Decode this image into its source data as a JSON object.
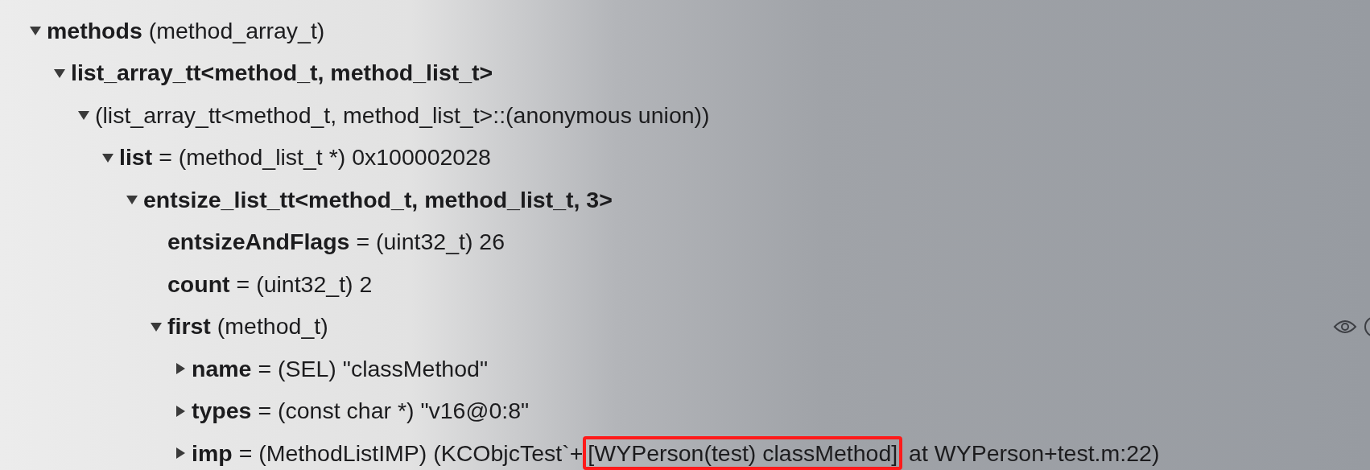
{
  "tree": [
    {
      "name": "methods",
      "value": "(method_array_t)",
      "expanded": true,
      "children": [
        {
          "name": "list_array_tt<method_t, method_list_t>",
          "expanded": true,
          "children": [
            {
              "value": "(list_array_tt<method_t, method_list_t>::(anonymous union))",
              "expanded": true,
              "children": [
                {
                  "name": "list",
                  "value": "= (method_list_t *) 0x100002028",
                  "expanded": true,
                  "children": [
                    {
                      "name": "entsize_list_tt<method_t, method_list_t, 3>",
                      "expanded": true,
                      "children": [
                        {
                          "name": "entsizeAndFlags",
                          "value": "= (uint32_t) 26"
                        },
                        {
                          "name": "count",
                          "value": "= (uint32_t) 2"
                        },
                        {
                          "name": "first",
                          "value": "(method_t)",
                          "expanded": true,
                          "actions": true,
                          "children": [
                            {
                              "name": "name",
                              "value": "= (SEL) \"classMethod\"",
                              "expanded": false
                            },
                            {
                              "name": "types",
                              "value": "= (const char *) \"v16@0:8\"",
                              "expanded": false
                            },
                            {
                              "name": "imp",
                              "value": "= (MethodListIMP) (KCObjcTest`+",
                              "highlight": "[WYPerson(test) classMethod]",
                              "value_end": " at WYPerson+test.m:22)",
                              "expanded": false
                            }
                          ]
                        }
                      ]
                    }
                  ]
                }
              ]
            }
          ]
        }
      ]
    }
  ]
}
